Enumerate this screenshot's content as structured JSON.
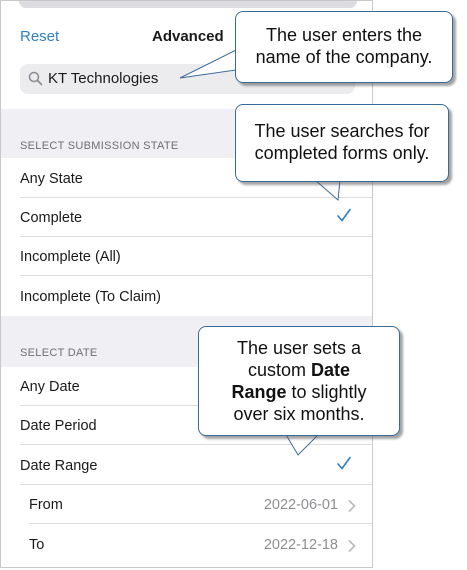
{
  "header": {
    "reset_label": "Reset",
    "title": "Advanced"
  },
  "search": {
    "icon": "search-icon",
    "value": "KT Technologies"
  },
  "submission_state": {
    "header": "SELECT SUBMISSION STATE",
    "options": [
      {
        "label": "Any State",
        "selected": false
      },
      {
        "label": "Complete",
        "selected": true
      },
      {
        "label": "Incomplete (All)",
        "selected": false
      },
      {
        "label": "Incomplete (To Claim)",
        "selected": false
      }
    ]
  },
  "date": {
    "header": "SELECT DATE",
    "options": [
      {
        "label": "Any Date",
        "selected": false
      },
      {
        "label": "Date Period",
        "selected": false
      },
      {
        "label": "Date Range",
        "selected": true
      }
    ],
    "from_label": "From",
    "from_value": "2022-06-01",
    "to_label": "To",
    "to_value": "2022-12-18"
  },
  "callouts": {
    "company_line1": "The user enters the",
    "company_line2": "name of the company.",
    "completed_line1": "The user searches for",
    "completed_line2": "completed forms only.",
    "date_line1": "The user sets a",
    "date_line2_pre": "custom ",
    "date_line2_bold": "Date",
    "date_line3_bold": "Range",
    "date_line3_post": " to slightly",
    "date_line4": "over six months."
  },
  "colors": {
    "accent": "#2f7fc1",
    "checkmark": "#2f7fc1",
    "callout_border": "#3a6a9a",
    "section_background": "#f0f0f4"
  }
}
